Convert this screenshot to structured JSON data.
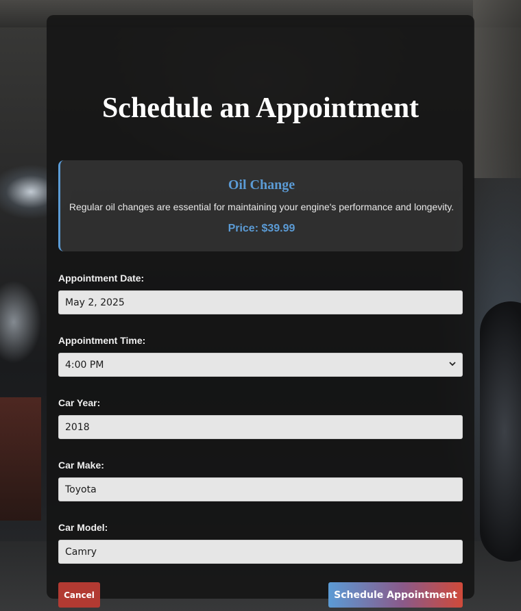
{
  "page_title": "Schedule an Appointment",
  "service": {
    "name": "Oil Change",
    "description": "Regular oil changes are essential for maintaining your engine's performance and longevity.",
    "price": "Price: $39.99"
  },
  "fields": {
    "date": {
      "label": "Appointment Date:",
      "value": "May 2, 2025"
    },
    "time": {
      "label": "Appointment Time:",
      "value": "4:00 PM"
    },
    "year": {
      "label": "Car Year:",
      "value": "2018"
    },
    "make": {
      "label": "Car Make:",
      "value": "Toyota"
    },
    "model": {
      "label": "Car Model:",
      "value": "Camry"
    }
  },
  "actions": {
    "cancel_label": "Cancel",
    "submit_label": "Schedule Appointment"
  },
  "icons": {
    "select_arrow": "chevron-down-icon"
  },
  "colors": {
    "accent_blue": "#5b9bd5",
    "cancel_red": "#b23a32",
    "submit_gradient_end": "#d04a3a"
  }
}
